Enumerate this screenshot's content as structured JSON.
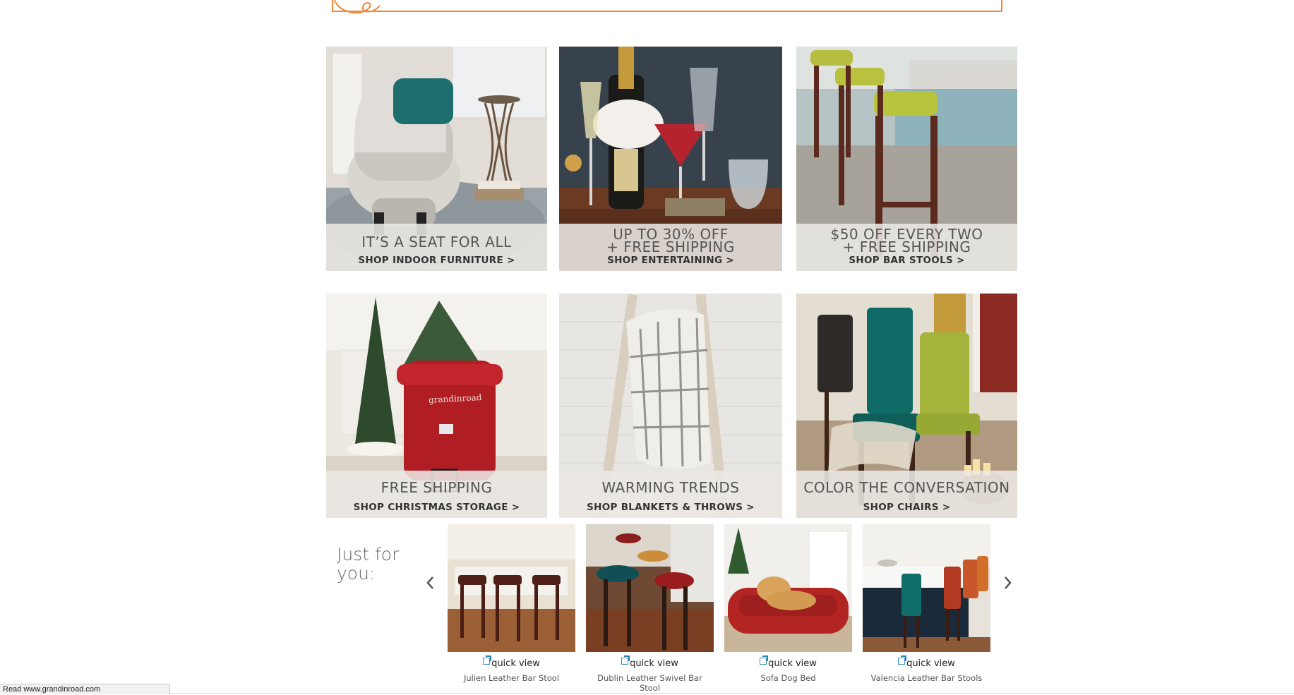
{
  "promos": [
    {
      "headline": "IT’S A SEAT FOR ALL",
      "link": "SHOP INDOOR FURNITURE >"
    },
    {
      "headline": "UP TO 30% OFF\n+ FREE SHIPPING",
      "link": "SHOP ENTERTAINING >"
    },
    {
      "headline": "$50 OFF EVERY TWO\n+ FREE SHIPPING",
      "link": "SHOP BAR STOOLS >"
    },
    {
      "headline": "FREE SHIPPING",
      "link": "SHOP CHRISTMAS STORAGE >"
    },
    {
      "headline": "WARMING TRENDS",
      "link": "SHOP BLANKETS & THROWS >"
    },
    {
      "headline": "COLOR THE CONVERSATION",
      "link": "SHOP CHAIRS >"
    }
  ],
  "just_for_you": {
    "title": "Just for you:",
    "quick_view_label": "quick view",
    "products": [
      {
        "name": "Julien Leather Bar Stool"
      },
      {
        "name": "Dublin Leather Swivel Bar Stool"
      },
      {
        "name": "Sofa Dog Bed"
      },
      {
        "name": "Valencia Leather Bar Stools"
      }
    ]
  },
  "bag_text": "grandinroad",
  "status_bar": "Read www.grandinroad.com",
  "colors": {
    "accent": "#f0883a",
    "caption_bg": "#ebe8e4",
    "quick_view_icon": "#2d7fb0"
  }
}
